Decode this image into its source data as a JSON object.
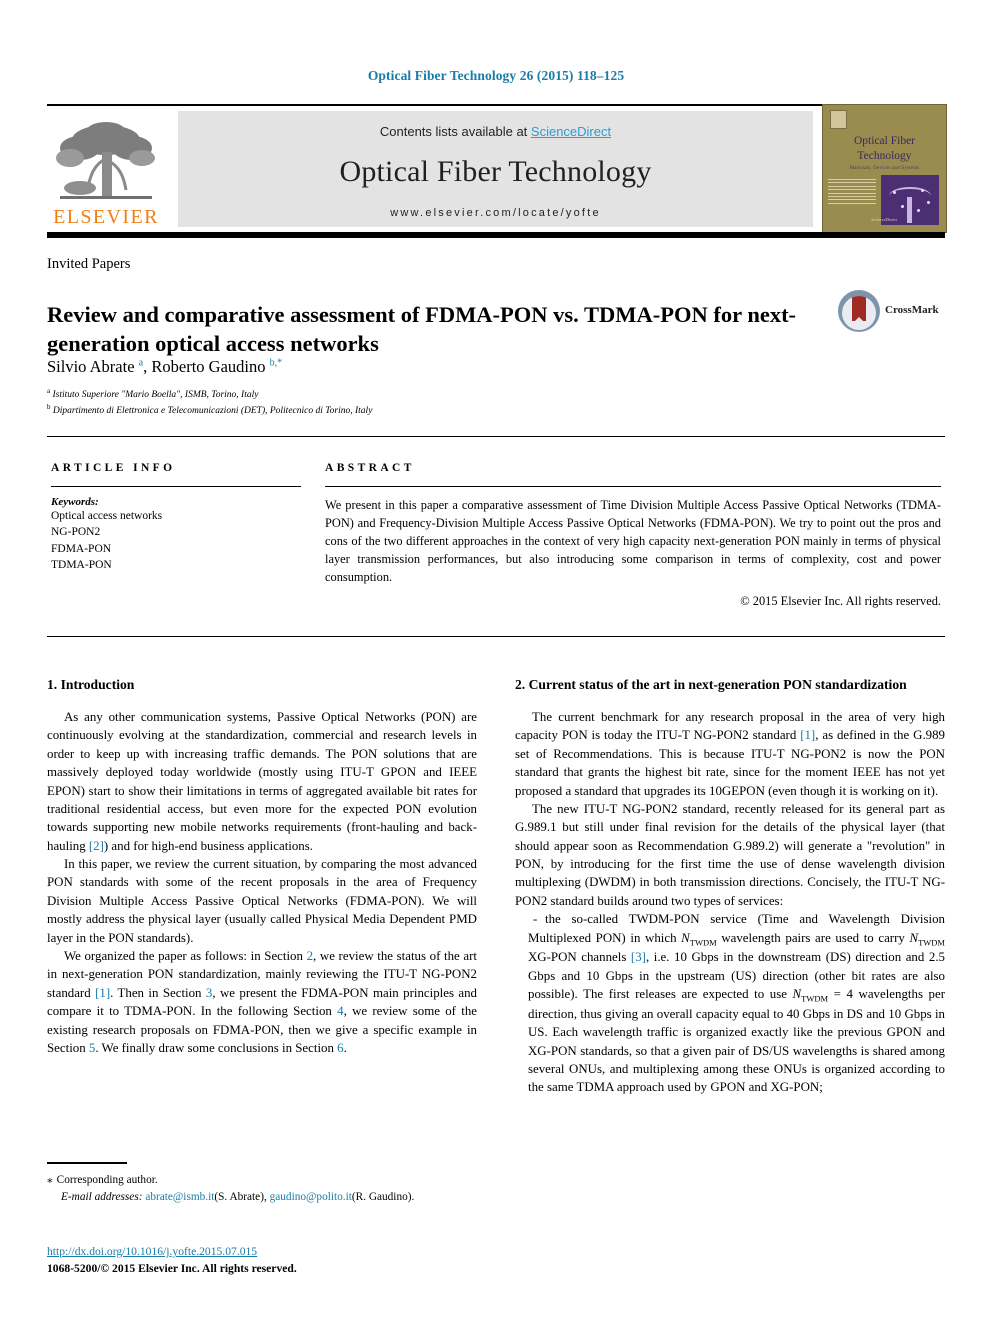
{
  "running_head": "Optical Fiber Technology 26 (2015) 118–125",
  "banner": {
    "contents_prefix": "Contents lists available at ",
    "sciencedirect": "ScienceDirect",
    "journal_title": "Optical Fiber Technology",
    "journal_url": "www.elsevier.com/locate/yofte",
    "publisher_wordmark": "ELSEVIER",
    "cover": {
      "line1": "Optical  Fiber",
      "line2": "Technology",
      "subtitle": "Materials, Devices and Systems",
      "footer": "ScienceDirect"
    }
  },
  "crossmark": {
    "label": "CrossMark"
  },
  "article": {
    "category": "Invited Papers",
    "title": "Review and comparative assessment of FDMA-PON vs. TDMA-PON for next-generation optical access networks",
    "authors_html": "Silvio Abrate <sup>a</sup>, Roberto Gaudino <sup>b,*</sup>",
    "affiliation_a": "Istituto Superiore \"Mario Boella\", ISMB, Torino, Italy",
    "affiliation_b": "Dipartimento di Elettronica e Telecomunicazioni (DET), Politecnico di Torino, Italy"
  },
  "info": {
    "heading": "ARTICLE INFO",
    "keywords_label": "Keywords:",
    "keywords": [
      "Optical access networks",
      "NG-PON2",
      "FDMA-PON",
      "TDMA-PON"
    ]
  },
  "abstract": {
    "heading": "ABSTRACT",
    "text": "We present in this paper a comparative assessment of Time Division Multiple Access Passive Optical Networks (TDMA-PON) and Frequency-Division Multiple Access Passive Optical Networks (FDMA-PON). We try to point out the pros and cons of the two different approaches in the context of very high capacity next-generation PON mainly in terms of physical layer transmission performances, but also introducing some comparison in terms of complexity, cost and power consumption.",
    "copyright": "© 2015 Elsevier Inc. All rights reserved."
  },
  "sections": {
    "intro_heading": "1. Introduction",
    "intro_p1": "As any other communication systems, Passive Optical Networks (PON) are continuously evolving at the standardization, commercial and research levels in order to keep up with increasing traffic demands. The PON solutions that are massively deployed today worldwide (mostly using ITU-T GPON and IEEE EPON) start to show their limitations in terms of aggregated available bit rates for traditional residential access, but even more for the expected PON evolution towards supporting new mobile networks requirements (front-hauling and back-hauling ",
    "intro_p1_ref": "[2]",
    "intro_p1_end": ") and for high-end business applications.",
    "intro_p2": "In this paper, we review the current situation, by comparing the most advanced PON standards with some of the recent proposals in the area of Frequency Division Multiple Access Passive Optical Networks (FDMA-PON). We will mostly address the physical layer (usually called Physical Media Dependent PMD layer in the PON standards).",
    "intro_p3_a": "We organized the paper as follows: in Section ",
    "intro_p3_s2": "2",
    "intro_p3_b": ", we review the status of the art in next-generation PON standardization, mainly reviewing the ITU-T NG-PON2 standard ",
    "intro_p3_r1": "[1]",
    "intro_p3_c": ". Then in Section ",
    "intro_p3_s3": "3",
    "intro_p3_d": ", we present the FDMA-PON main principles and compare it to TDMA-PON. In the following Section ",
    "intro_p3_s4": "4",
    "intro_p3_e": ", we review some of the existing research proposals on FDMA-PON, then we give a specific example in Section ",
    "intro_p3_s5": "5",
    "intro_p3_f": ". We finally draw some conclusions in Section ",
    "intro_p3_s6": "6",
    "intro_p3_g": ".",
    "status_heading": "2. Current status of the art in next-generation PON standardization",
    "status_p1_a": "The current benchmark for any research proposal in the area of very high capacity PON is today the ITU-T NG-PON2 standard ",
    "status_p1_ref": "[1]",
    "status_p1_b": ", as defined in the G.989 set of Recommendations. This is because ITU-T NG-PON2 is now the PON standard that grants the highest bit rate, since for the moment IEEE has not yet proposed a standard that upgrades its 10GEPON (even though it is working on it).",
    "status_p2": "The new ITU-T NG-PON2 standard, recently released for its general part as G.989.1 but still under final revision for the details of the physical layer (that should appear soon as Recommendation G.989.2) will generate a \"revolution\" in PON, by introducing for the first time the use of dense wavelength division multiplexing (DWDM) in both transmission directions. Concisely, the ITU-T NG-PON2 standard builds around two types of services:",
    "bullet1_a": "the so-called TWDM-PON service (Time and Wavelength Division Multiplexed PON) in which ",
    "bullet1_var1": "N",
    "bullet1_sub1": "TWDM",
    "bullet1_b": " wavelength pairs are used to carry ",
    "bullet1_var2": "N",
    "bullet1_sub2": "TWDM",
    "bullet1_c": " XG-PON channels ",
    "bullet1_ref": "[3]",
    "bullet1_d": ", i.e. 10 Gbps in the downstream (DS) direction and 2.5 Gbps and 10 Gbps in the upstream (US) direction (other bit rates are also possible). The first releases are expected to use ",
    "bullet1_var3": "N",
    "bullet1_sub3": "TWDM",
    "bullet1_e": " = 4 wavelengths per direction, thus giving an overall capacity equal to 40 Gbps in DS and 10 Gbps in US. Each wavelength traffic is organized exactly like the previous GPON and XG-PON standards, so that a given pair of DS/US wavelengths is shared among several ONUs, and multiplexing among these ONUs is organized according to the same TDMA approach used by GPON and XG-PON;"
  },
  "footnotes": {
    "corresponding_mark": "⁎",
    "corresponding_text": "Corresponding author.",
    "email_label": "E-mail addresses:",
    "email1": "abrate@ismb.it",
    "email1_owner": "(S. Abrate)",
    "email2": "gaudino@polito.it",
    "email2_owner": "(R. Gaudino)",
    "doi": "http://dx.doi.org/10.1016/j.yofte.2015.07.015",
    "issn": "1068-5200/© 2015 Elsevier Inc. All rights reserved."
  }
}
